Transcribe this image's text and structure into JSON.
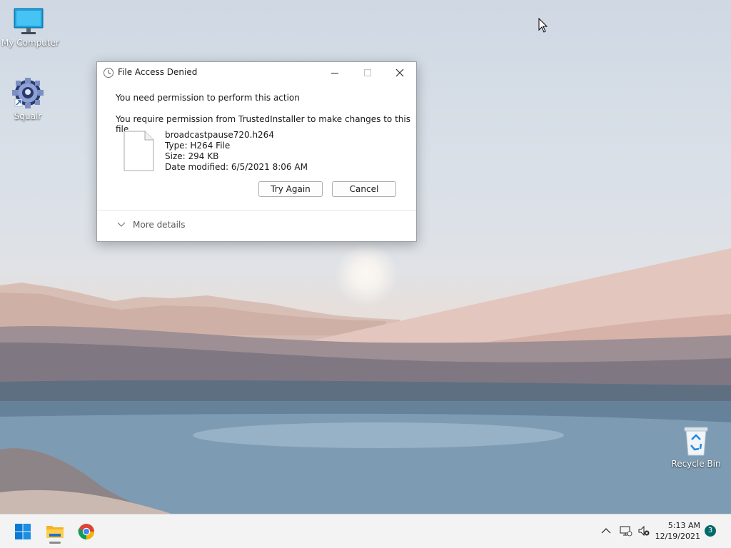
{
  "desktop": {
    "icons": [
      {
        "label": "My Computer",
        "icon": "monitor-icon"
      },
      {
        "label": "Squalr",
        "icon": "squalr-gear-icon"
      },
      {
        "label": "Recycle Bin",
        "icon": "recycle-bin-icon"
      }
    ]
  },
  "dialog": {
    "title": "File Access Denied",
    "message": "You need permission to perform this action",
    "detail": "You require permission from TrustedInstaller to make changes to this file",
    "file": {
      "name": "broadcastpause720.h264",
      "type": "Type: H264 File",
      "size": "Size: 294 KB",
      "modified": "Date modified: 6/5/2021 8:06 AM"
    },
    "buttons": {
      "try_again": "Try Again",
      "cancel": "Cancel"
    },
    "more_details": "More details"
  },
  "taskbar": {
    "pinned": [
      "start-windows-icon",
      "file-explorer-icon",
      "chrome-icon"
    ],
    "tray": [
      "chevron-up-icon",
      "network-icon",
      "volume-muted-icon"
    ],
    "time": "5:13 AM",
    "date": "12/19/2021",
    "notification_count": "3"
  }
}
